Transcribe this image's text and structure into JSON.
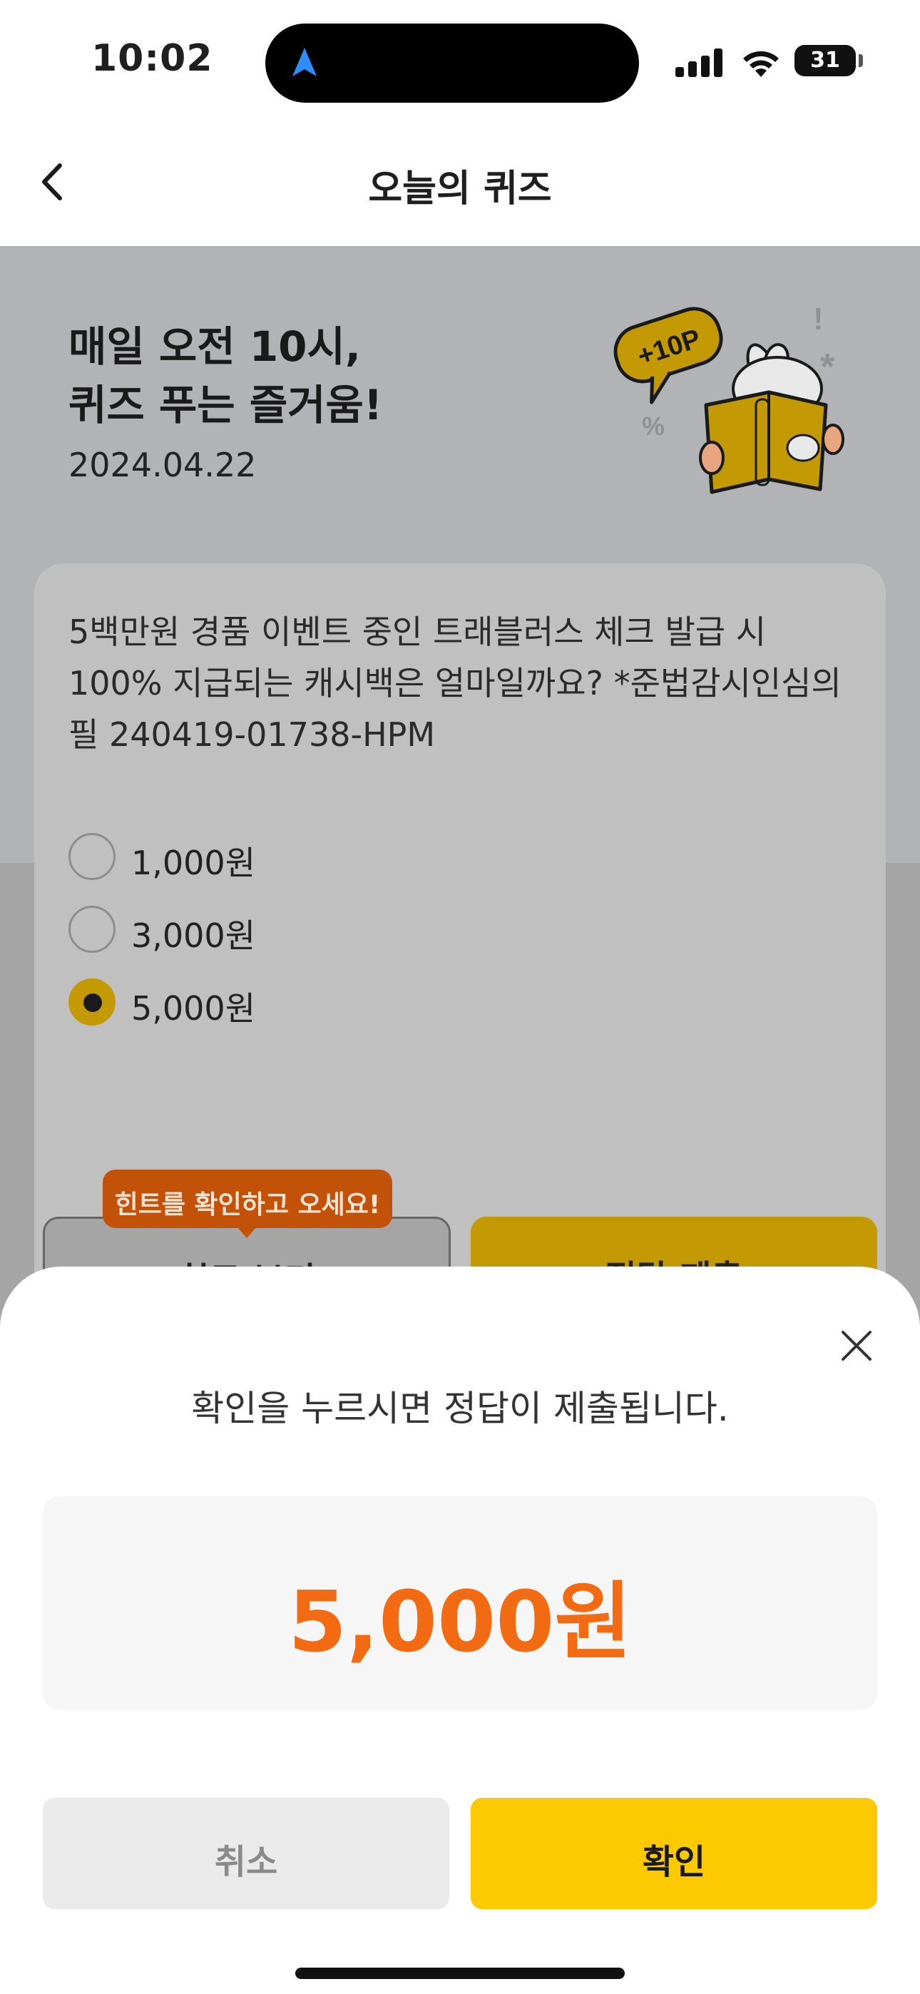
{
  "status_bar": {
    "time": "10:02",
    "battery": "31"
  },
  "header": {
    "title": "오늘의 퀴즈"
  },
  "hero": {
    "title": "매일 오전 10시,\n퀴즈 푸는 즐거움!",
    "date": "2024.04.22",
    "badge": "+10P"
  },
  "quiz": {
    "question": "5백만원 경품 이벤트 중인 트래블러스 체크 발급 시 100% 지급되는 캐시백은 얼마일까요? *준법감시인심의필 240419-01738-HPM",
    "options": [
      {
        "label": "1,000원",
        "selected": false
      },
      {
        "label": "3,000원",
        "selected": false
      },
      {
        "label": "5,000원",
        "selected": true
      }
    ],
    "hint_label": "힌트 보기",
    "submit_label": "정답 제출",
    "tooltip": "힌트를 확인하고 오세요!"
  },
  "sheet": {
    "message": "확인을 누르시면 정답이 제출됩니다.",
    "answer": "5,000원",
    "cancel_label": "취소",
    "confirm_label": "확인"
  },
  "colors": {
    "accent_orange": "#f26a12",
    "confirm_yellow": "#fdc900",
    "tooltip_orange": "#c35209"
  }
}
